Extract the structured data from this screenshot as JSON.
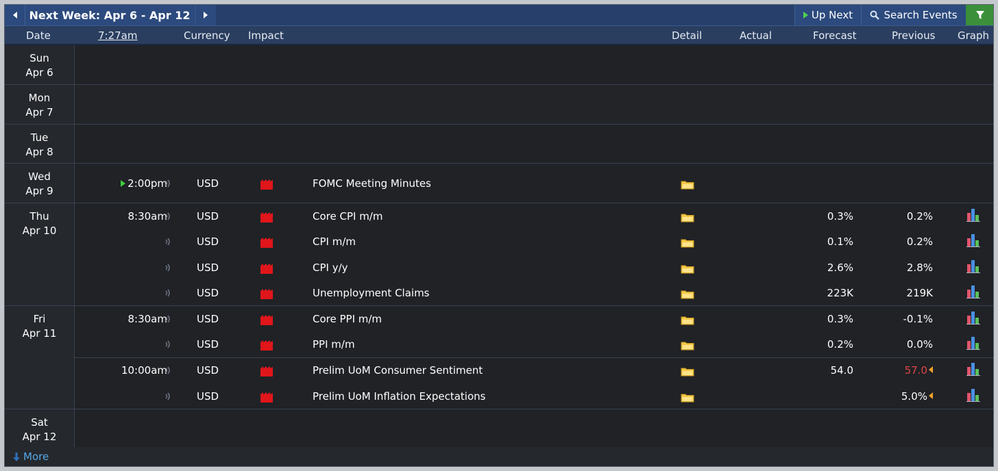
{
  "toolbar": {
    "title": "Next Week: Apr 6 - Apr 12",
    "up_next": "Up Next",
    "search_events": "Search Events"
  },
  "columns": {
    "date": "Date",
    "time": "7:27am",
    "currency": "Currency",
    "impact": "Impact",
    "detail": "Detail",
    "actual": "Actual",
    "forecast": "Forecast",
    "previous": "Previous",
    "graph": "Graph"
  },
  "days": [
    {
      "dow": "Sun",
      "date": "Apr 6"
    },
    {
      "dow": "Mon",
      "date": "Apr 7"
    },
    {
      "dow": "Tue",
      "date": "Apr 8"
    },
    {
      "dow": "Wed",
      "date": "Apr 9"
    },
    {
      "dow": "Thu",
      "date": "Apr 10"
    },
    {
      "dow": "Fri",
      "date": "Apr 11"
    },
    {
      "dow": "Sat",
      "date": "Apr 12"
    }
  ],
  "events": [
    {
      "time": "2:00pm",
      "currency": "USD",
      "impact": "high",
      "name": "FOMC Meeting Minutes",
      "forecast": "",
      "previous": "",
      "graph": false
    },
    {
      "time": "8:30am",
      "currency": "USD",
      "impact": "high",
      "name": "Core CPI m/m",
      "forecast": "0.3%",
      "previous": "0.2%",
      "graph": true
    },
    {
      "time": "",
      "currency": "USD",
      "impact": "high",
      "name": "CPI m/m",
      "forecast": "0.1%",
      "previous": "0.2%",
      "graph": true
    },
    {
      "time": "",
      "currency": "USD",
      "impact": "high",
      "name": "CPI y/y",
      "forecast": "2.6%",
      "previous": "2.8%",
      "graph": true
    },
    {
      "time": "",
      "currency": "USD",
      "impact": "high",
      "name": "Unemployment Claims",
      "forecast": "223K",
      "previous": "219K",
      "graph": true
    },
    {
      "time": "8:30am",
      "currency": "USD",
      "impact": "high",
      "name": "Core PPI m/m",
      "forecast": "0.3%",
      "previous": "-0.1%",
      "graph": true
    },
    {
      "time": "",
      "currency": "USD",
      "impact": "high",
      "name": "PPI m/m",
      "forecast": "0.2%",
      "previous": "0.0%",
      "graph": true
    },
    {
      "time": "10:00am",
      "currency": "USD",
      "impact": "high",
      "name": "Prelim UoM Consumer Sentiment",
      "forecast": "54.0",
      "previous": "57.0",
      "previous_revised": true,
      "graph": true
    },
    {
      "time": "",
      "currency": "USD",
      "impact": "high",
      "name": "Prelim UoM Inflation Expectations",
      "forecast": "",
      "previous": "5.0%",
      "previous_revised_marker": true,
      "graph": true
    }
  ],
  "footer": {
    "more": "More"
  },
  "colors": {
    "accent_green": "#3b8f3b",
    "impact_high": "#e0161b",
    "revised_red": "#e24545",
    "link_blue": "#57a8e8"
  }
}
